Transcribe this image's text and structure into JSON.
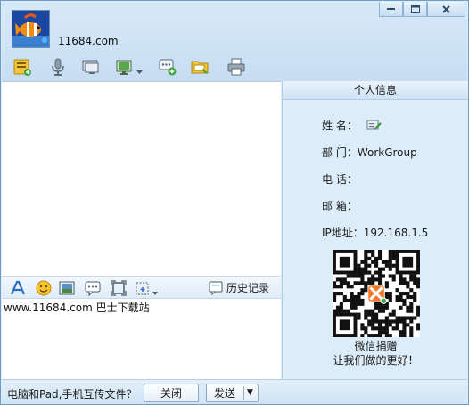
{
  "window": {
    "minimize_icon": "minimize-icon",
    "maximize_icon": "maximize-icon",
    "close_icon": "close-icon"
  },
  "contact": {
    "name": "11684.com",
    "avatar_icon": "clownfish-avatar"
  },
  "toolbar": {
    "icons": [
      "send-file-icon",
      "microphone-icon",
      "remote-desktop-icon",
      "screen-share-icon",
      "message-add-icon",
      "shared-folder-icon",
      "printer-icon"
    ]
  },
  "edit_toolbar": {
    "icons": [
      "font-icon",
      "emoji-icon",
      "image-icon",
      "message-bubble-icon",
      "screenshot-icon",
      "capture-options-icon"
    ],
    "history_label": "历史记录"
  },
  "input": {
    "text": "www.11684.com 巴士下载站"
  },
  "side_panel": {
    "title": "个人信息",
    "name_label": "姓 名：",
    "dept_label": "部 门：",
    "dept_value": "WorkGroup",
    "phone_label": "电 话：",
    "email_label": "邮 箱：",
    "ip_label": "IP地址：",
    "ip_value": "192.168.1.5",
    "qr_caption_1": "微信捐赠",
    "qr_caption_2": "让我们做的更好！"
  },
  "bottom": {
    "hint": "电脑和Pad,手机互传文件？",
    "close_label": "关闭",
    "send_label": "发送"
  },
  "colors": {
    "accent": "#dcecf9",
    "border": "#6f9bc4"
  }
}
